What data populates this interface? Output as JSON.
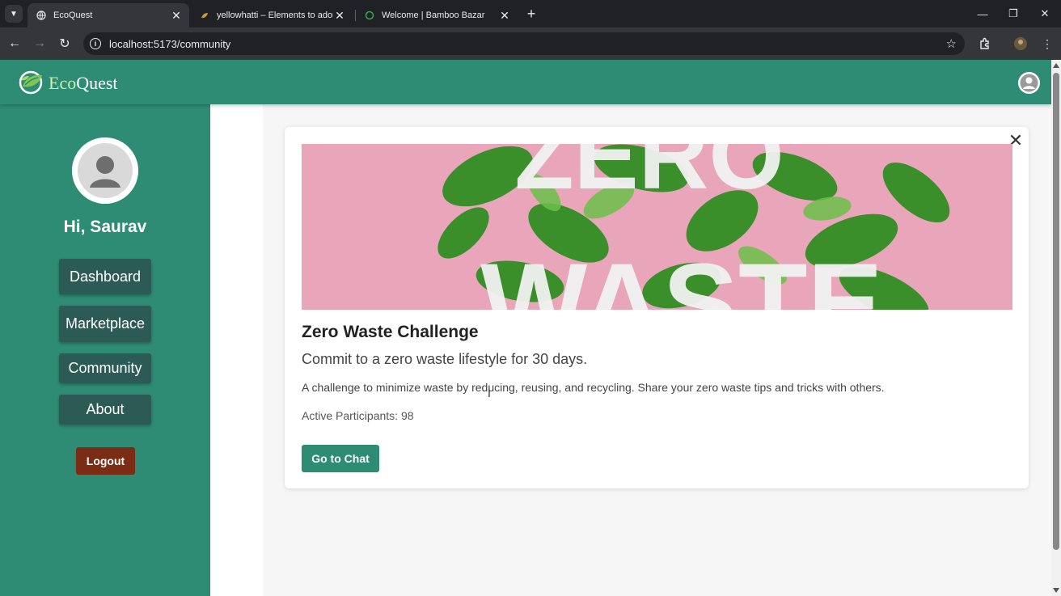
{
  "browser": {
    "tabs": [
      {
        "title": "EcoQuest",
        "active": true
      },
      {
        "title": "yellowhatti – Elements to adorn",
        "active": false
      },
      {
        "title": "Welcome | Bamboo Bazar",
        "active": false
      }
    ],
    "url": "localhost:5173/community"
  },
  "header": {
    "brand_eco": "Eco",
    "brand_quest": "Quest",
    "accent_color": "#2e8b74"
  },
  "sidebar": {
    "greeting": "Hi, Saurav",
    "items": [
      {
        "label": "Dashboard"
      },
      {
        "label": "Marketplace"
      },
      {
        "label": "Community"
      },
      {
        "label": "About"
      }
    ],
    "logout_label": "Logout"
  },
  "challenge": {
    "image_word_1": "ZERO",
    "image_word_2": "WASTE",
    "title": "Zero Waste Challenge",
    "subtitle": "Commit to a zero waste lifestyle for 30 days.",
    "description": "A challenge to minimize waste by reducing, reusing, and recycling. Share your zero waste tips and tricks with others.",
    "participants": "Active Participants: 98",
    "button_label": "Go to Chat"
  }
}
